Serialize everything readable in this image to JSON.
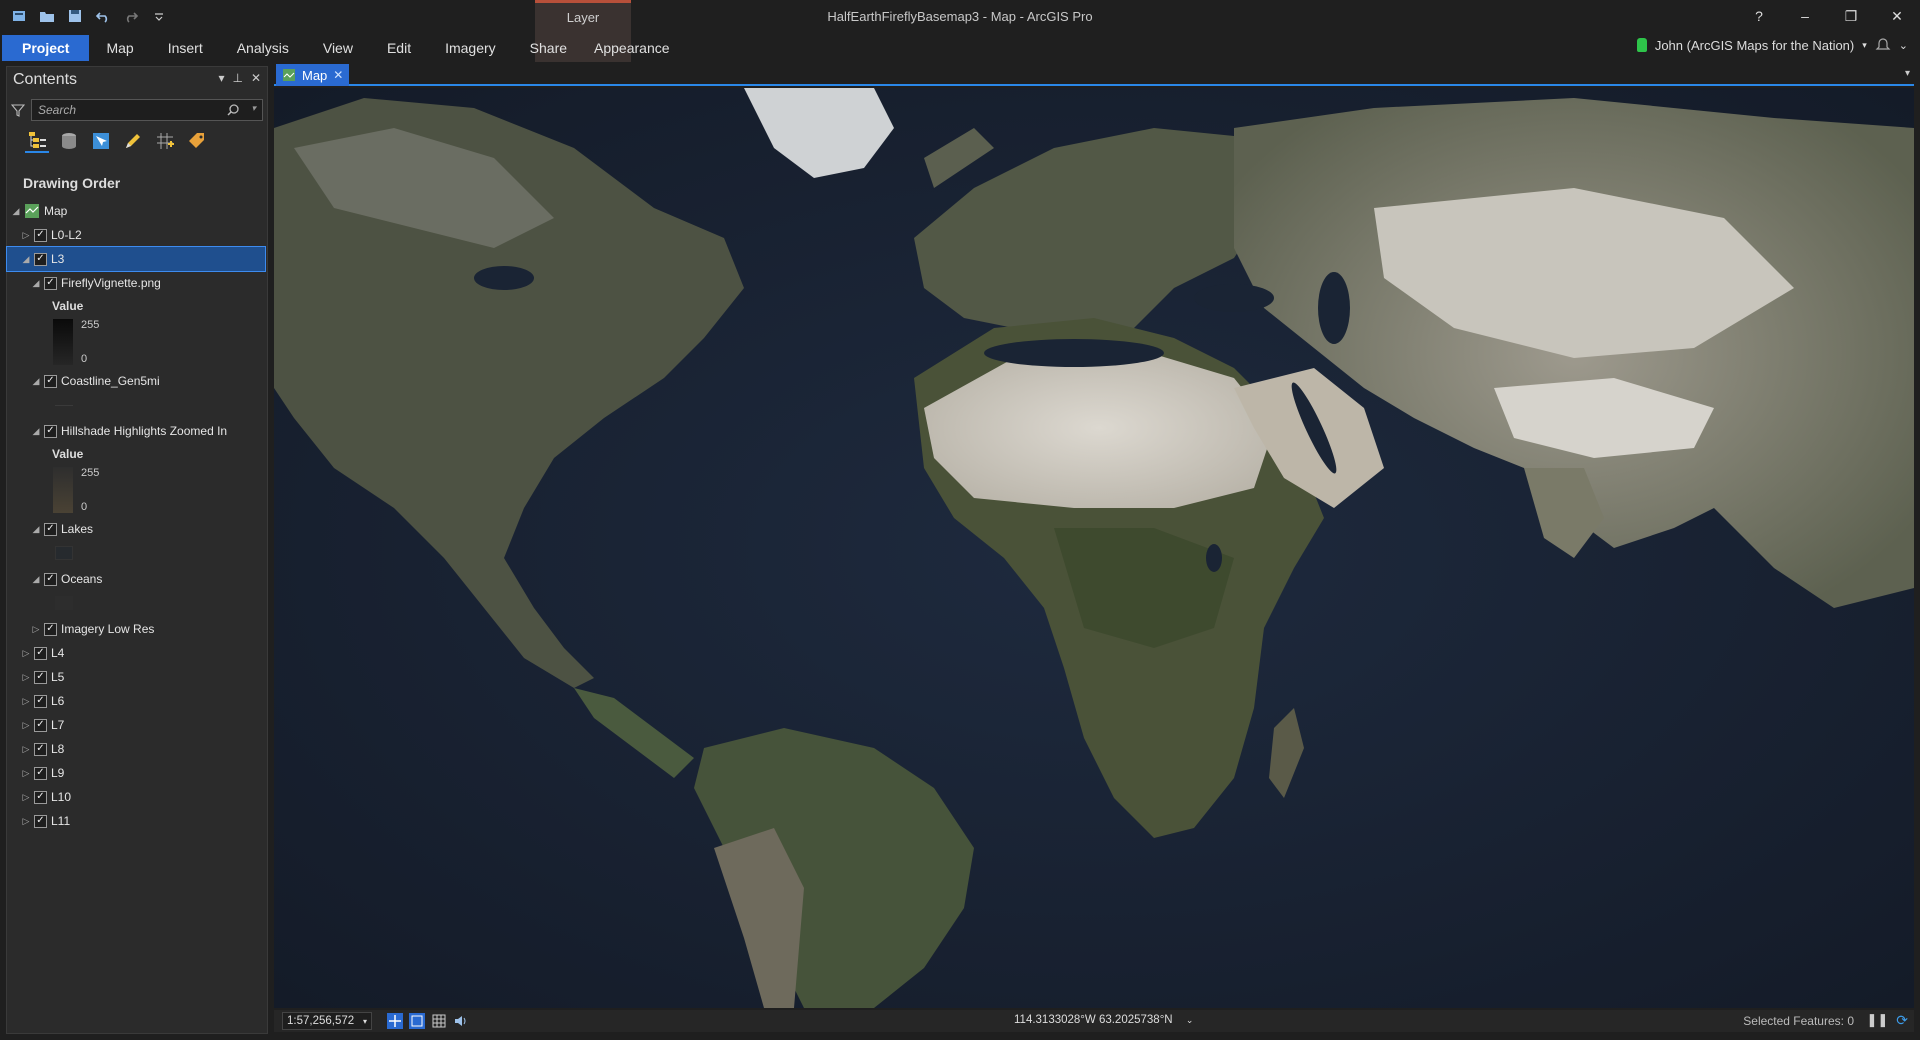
{
  "app": {
    "title": "HalfEarthFireflyBasemap3 - Map - ArcGIS Pro",
    "context_group": "Layer",
    "window_controls": [
      "?",
      "–",
      "❐",
      "✕"
    ]
  },
  "ribbon": {
    "tabs": [
      "Project",
      "Map",
      "Insert",
      "Analysis",
      "View",
      "Edit",
      "Imagery",
      "Share",
      "Appearance"
    ],
    "active_tab": "Project"
  },
  "user": {
    "name": "John (ArcGIS Maps for the Nation)"
  },
  "contents": {
    "title": "Contents",
    "search_placeholder": "Search",
    "section": "Drawing Order",
    "root": "Map",
    "layers": {
      "l0": "L0-L2",
      "l3": "L3",
      "firefly": "FireflyVignette.png",
      "coastline": "Coastline_Gen5mi",
      "hillshade": "Hillshade Highlights Zoomed In",
      "lakes": "Lakes",
      "oceans": "Oceans",
      "imagery": "Imagery Low Res",
      "l4": "L4",
      "l5": "L5",
      "l6": "L6",
      "l7": "L7",
      "l8": "L8",
      "l9": "L9",
      "l10": "L10",
      "l11": "L11"
    },
    "legend": {
      "value_label": "Value",
      "high": "255",
      "low": "0"
    }
  },
  "map_tab": {
    "label": "Map"
  },
  "status": {
    "scale": "1:57,256,572",
    "coordinates": "114.3133028°W 63.2025738°N",
    "selected_features": "Selected Features: 0"
  },
  "colors": {
    "accent": "#2a87e8",
    "project_tab": "#2a6ad1",
    "context_group_border": "#b7503a",
    "ocean": "#1b2436",
    "land": "#4a5240",
    "desert": "#cfcbc3"
  }
}
